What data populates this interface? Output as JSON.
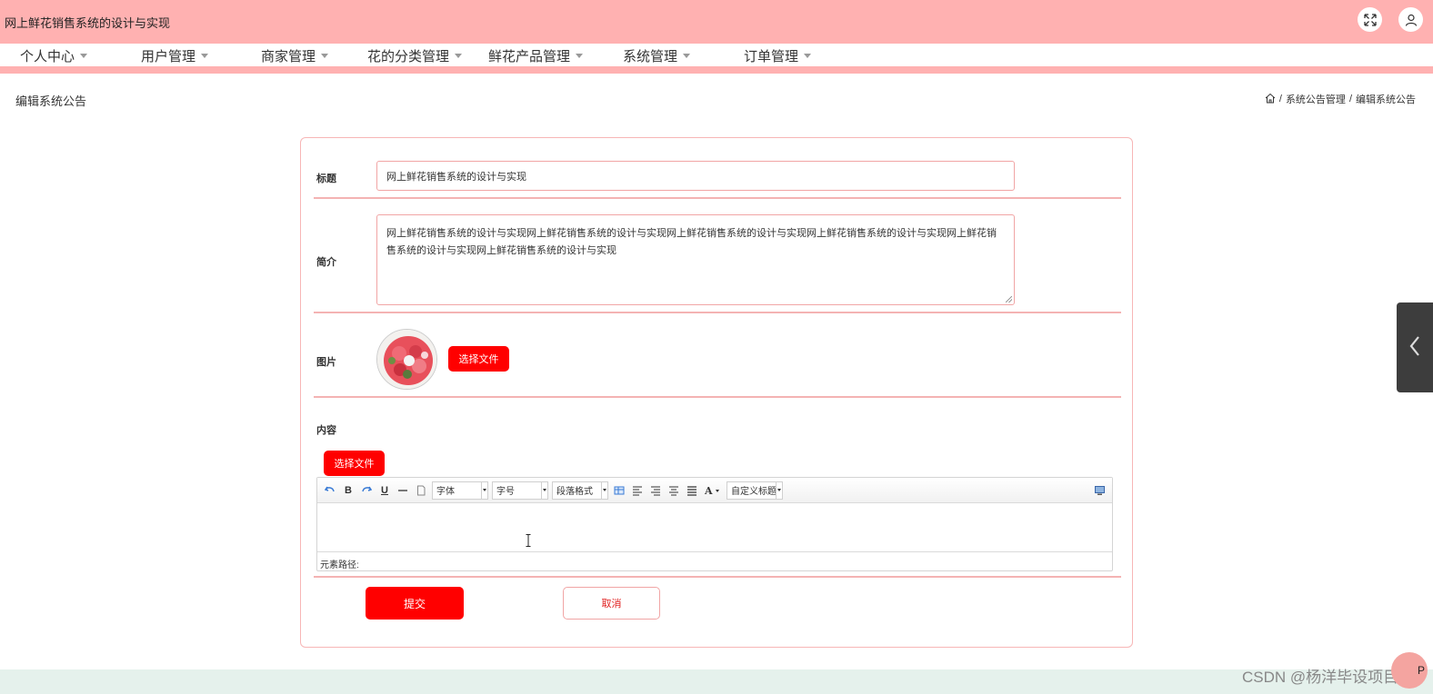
{
  "header": {
    "title": "网上鲜花销售系统的设计与实现",
    "icons": [
      "fullscreen-icon",
      "user-icon"
    ]
  },
  "nav": {
    "items": [
      {
        "label": "个人中心"
      },
      {
        "label": "用户管理"
      },
      {
        "label": "商家管理"
      },
      {
        "label": "花的分类管理"
      },
      {
        "label": "鲜花产品管理"
      },
      {
        "label": "系统管理"
      },
      {
        "label": "订单管理"
      }
    ]
  },
  "page": {
    "title": "编辑系统公告",
    "breadcrumb": [
      "系统公告管理",
      "编辑系统公告"
    ]
  },
  "form": {
    "title_label": "标题",
    "title_value": "网上鲜花销售系统的设计与实现",
    "intro_label": "简介",
    "intro_value": "网上鲜花销售系统的设计与实现网上鲜花销售系统的设计与实现网上鲜花销售系统的设计与实现网上鲜花销售系统的设计与实现网上鲜花销售系统的设计与实现网上鲜花销售系统的设计与实现",
    "image_label": "图片",
    "choose_file": "选择文件",
    "content_label": "内容",
    "content_choose_file": "选择文件",
    "submit": "提交",
    "cancel": "取消"
  },
  "editor": {
    "font_family": "字体",
    "font_size": "字号",
    "paragraph": "段落格式",
    "custom_title": "自定义标题",
    "element_path": "元素路径:"
  },
  "watermark": "CSDN @杨洋毕设项目",
  "float_button": "P",
  "colors": {
    "header_bg": "#ffb1b1",
    "accent_red": "#ff0000",
    "border_pink": "#f1a5a5",
    "footer_bg": "#e5f1ec"
  }
}
